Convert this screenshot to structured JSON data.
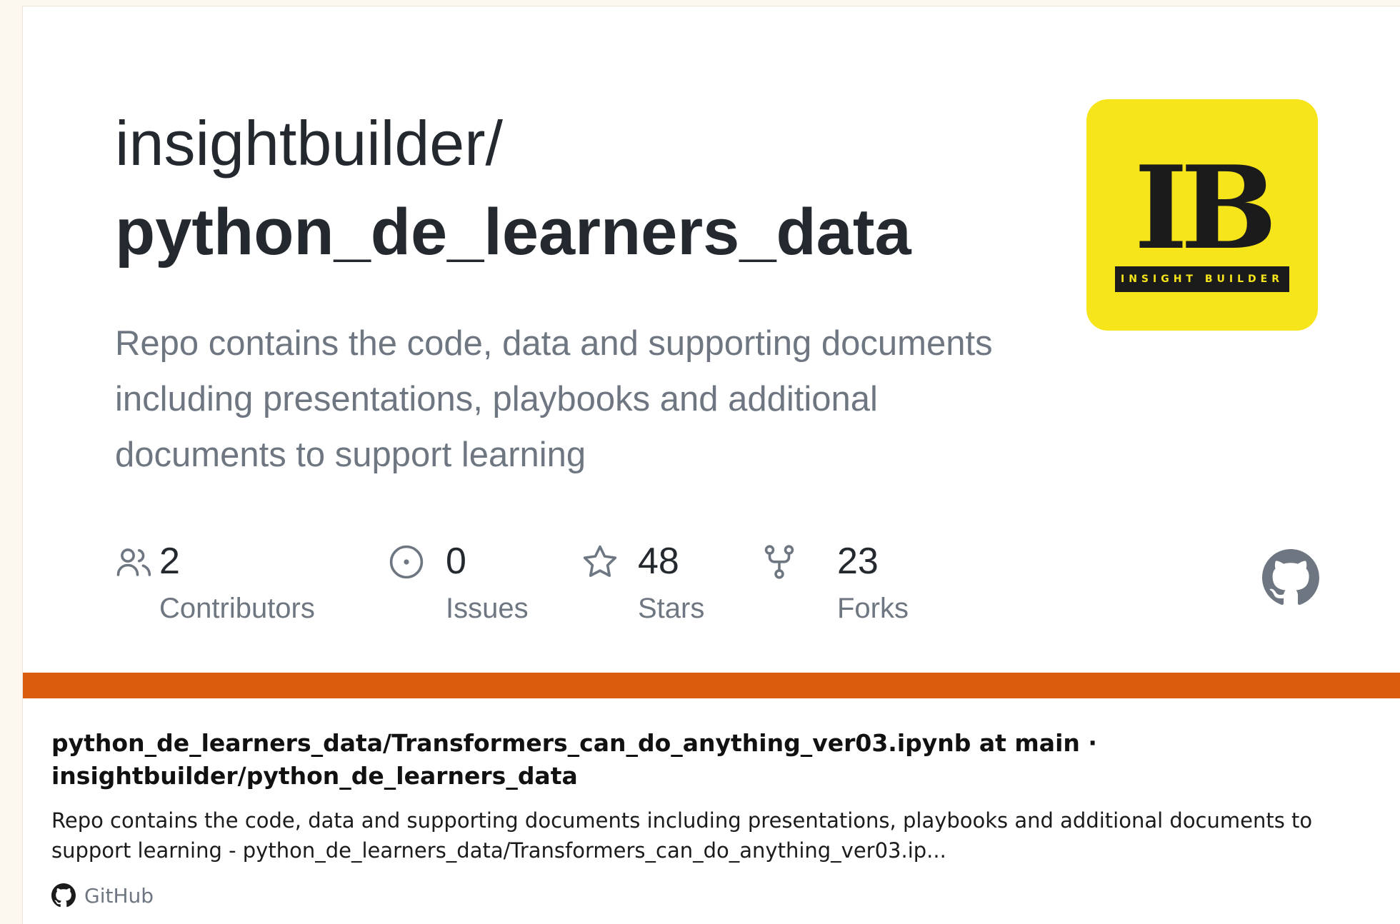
{
  "repo_card": {
    "owner": "insightbuilder/",
    "repo_name": "python_de_learners_data",
    "description": "Repo contains the code, data and supporting documents including presentations, playbooks and additional documents to support learning",
    "logo": {
      "letters": "IB",
      "tagline": "INSIGHT BUILDER",
      "background_color": "#f7e51b",
      "text_color": "#1b1b1b"
    },
    "stats": [
      {
        "icon": "people-icon",
        "value": "2",
        "label": "Contributors"
      },
      {
        "icon": "issue-icon",
        "value": "0",
        "label": "Issues"
      },
      {
        "icon": "star-icon",
        "value": "48",
        "label": "Stars"
      },
      {
        "icon": "fork-icon",
        "value": "23",
        "label": "Forks"
      }
    ],
    "accent_color": "#da5b0b"
  },
  "link_preview": {
    "title": "python_de_learners_data/Transformers_can_do_anything_ver03.ipynb at main · insightbuilder/python_de_learners_data",
    "description": "Repo contains the code, data and supporting documents including presentations, playbooks and additional documents to support learning - python_de_learners_data/Transformers_can_do_anything_ver03.ip...",
    "source": "GitHub"
  }
}
